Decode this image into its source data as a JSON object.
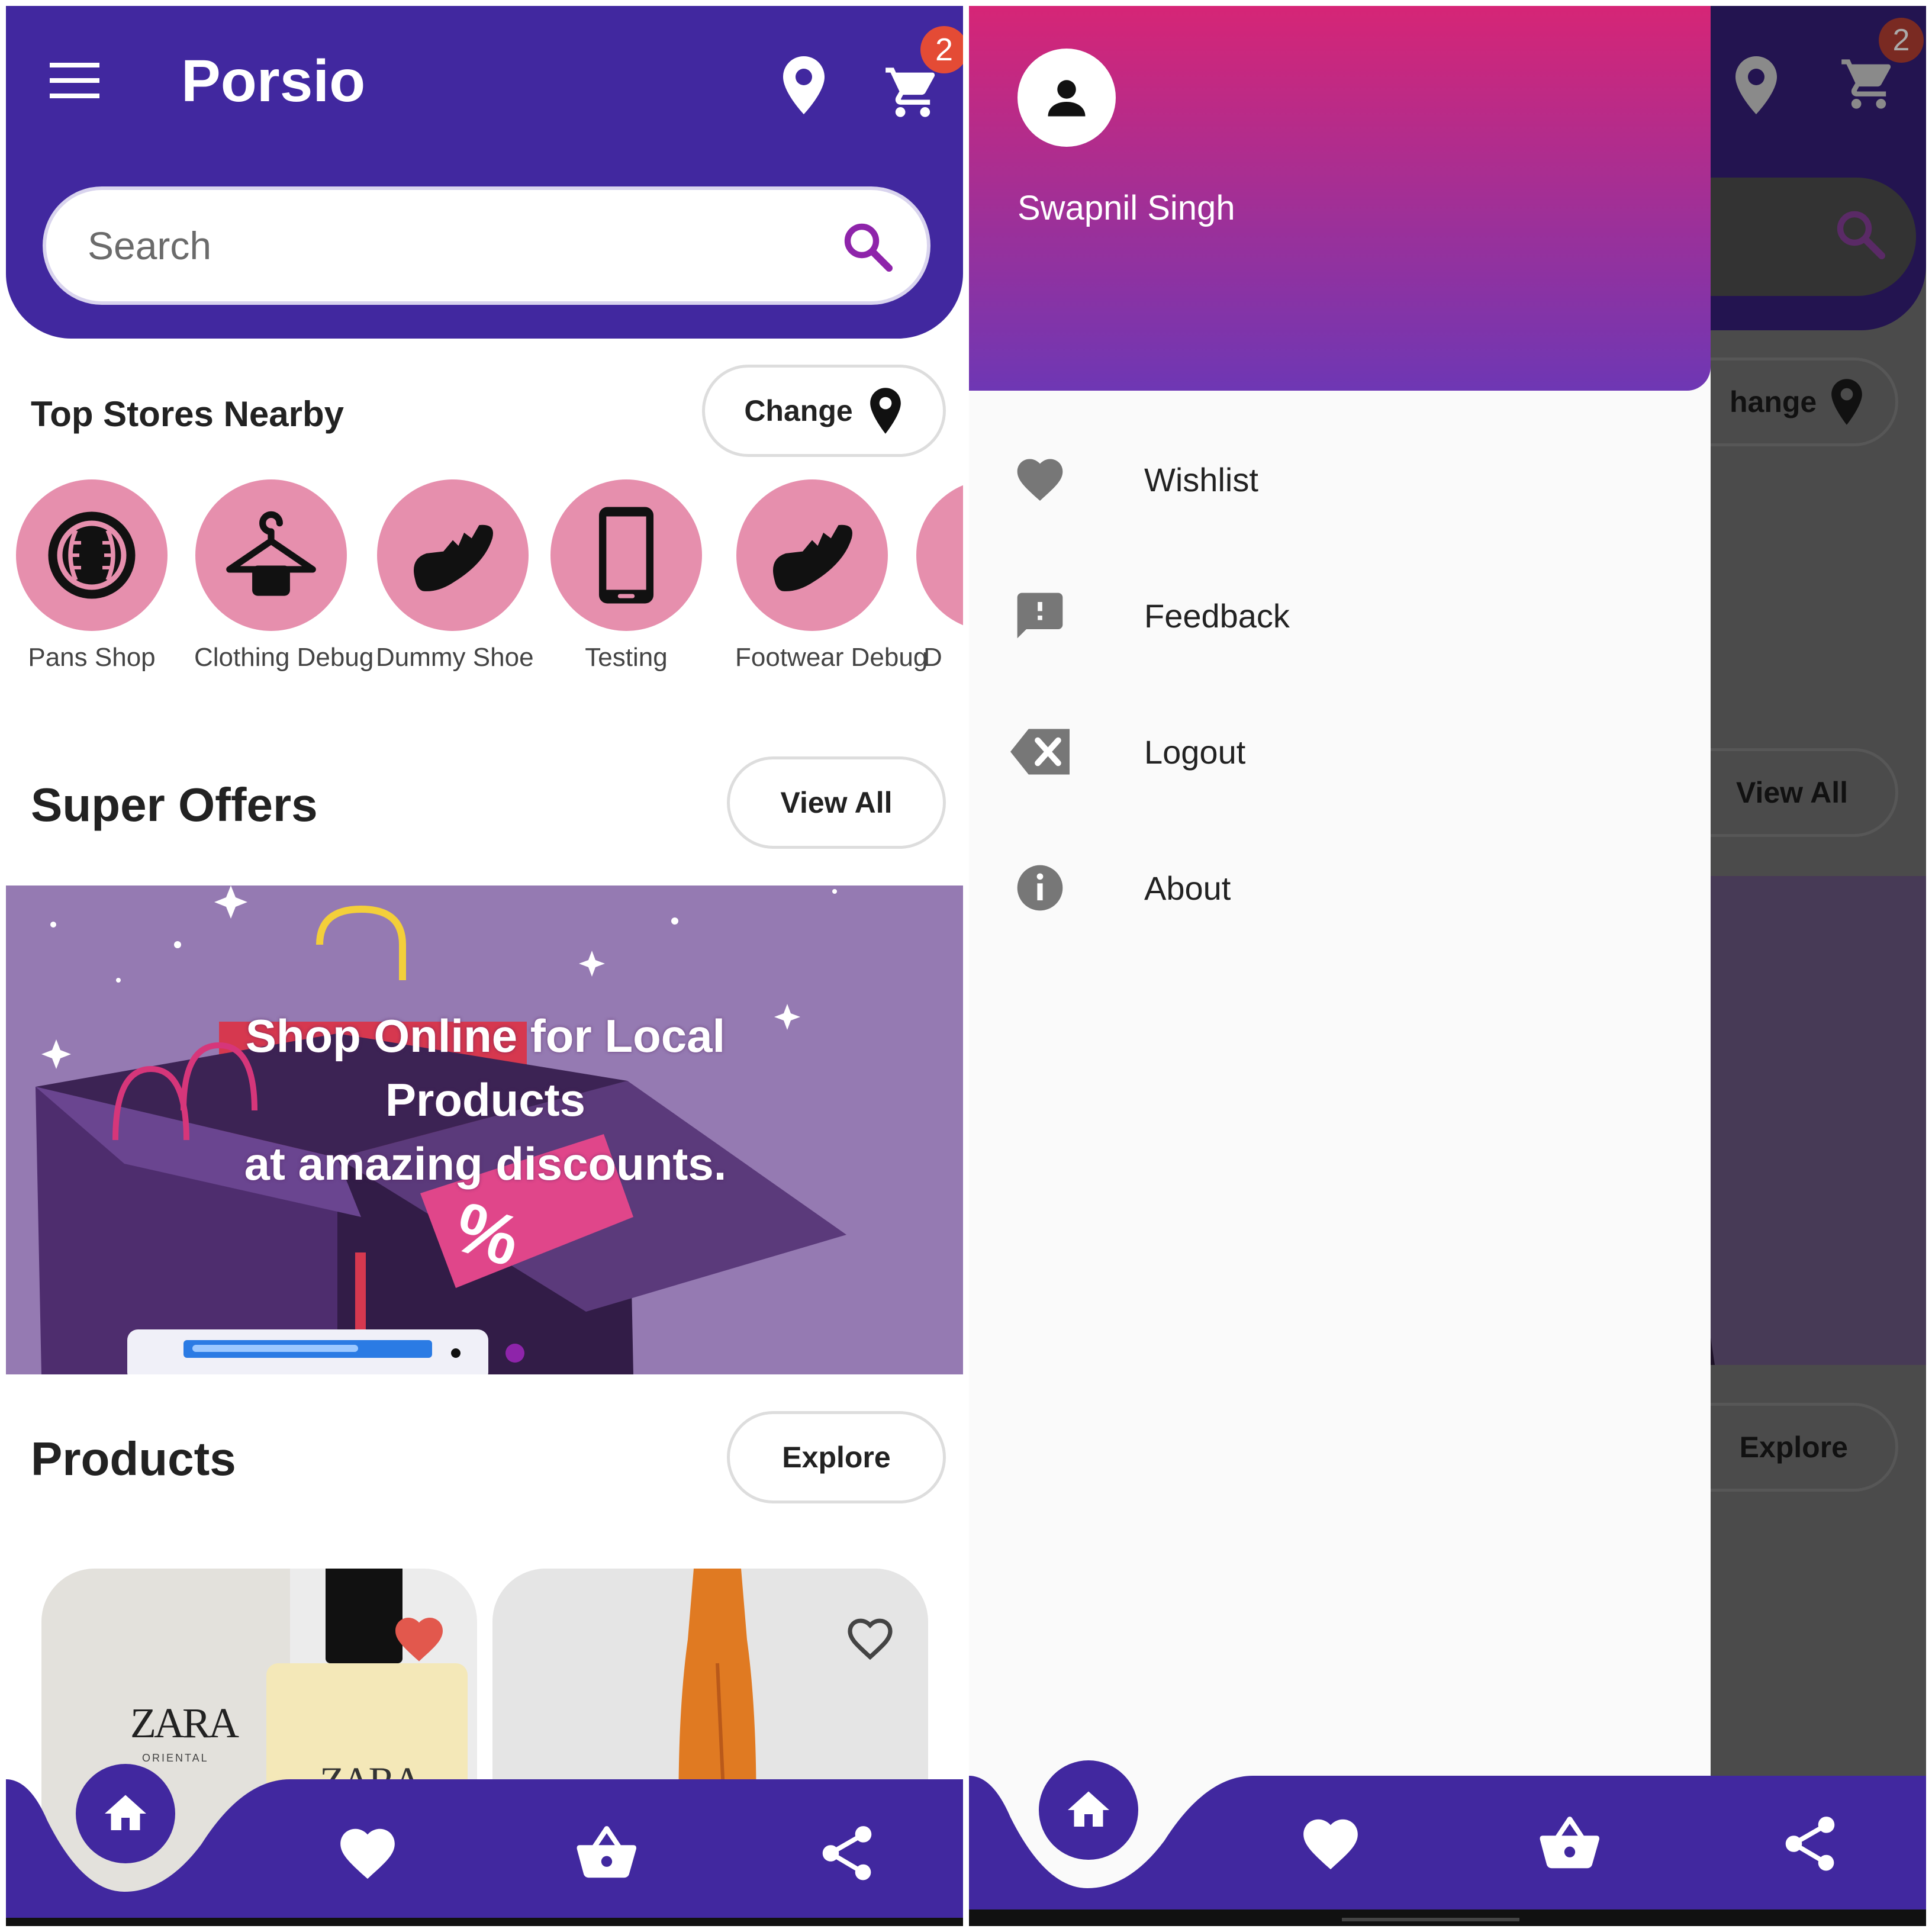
{
  "colors": {
    "primary": "#41289f",
    "accent_pink": "#e68fad",
    "badge": "#e44b35",
    "search_icon": "#8e24aa",
    "drawer_gradient_top": "#d62576",
    "drawer_gradient_bottom": "#6e37b4"
  },
  "home": {
    "app_title": "Porsio",
    "cart_count": "2",
    "search": {
      "placeholder": "Search"
    },
    "stores_section": {
      "title": "Top Stores Nearby",
      "change_label": "Change",
      "stores": [
        {
          "label": "Pans Shop",
          "icon": "baseball-icon"
        },
        {
          "label": "Clothing Debug",
          "icon": "hanger-icon"
        },
        {
          "label": "Dummy Shoe",
          "icon": "shoe-icon"
        },
        {
          "label": "Testing",
          "icon": "phone-icon"
        },
        {
          "label": "Footwear Debug",
          "icon": "shoe-icon"
        },
        {
          "label": "D",
          "icon": "store-icon"
        }
      ]
    },
    "offers_section": {
      "title": "Super Offers",
      "view_all_label": "View All",
      "banner_line1": "Shop Online for Local",
      "banner_line2": "Products",
      "banner_line3": "at amazing discounts.",
      "banner_tag": "%"
    },
    "products_section": {
      "title": "Products",
      "explore_label": "Explore",
      "items": [
        {
          "brand_text": "ZARA",
          "brand_sub": "ORIENTAL",
          "bottle_text": "ZARA",
          "wishlisted": true
        },
        {
          "wishlisted": false
        }
      ]
    },
    "bottom_nav": [
      "home-icon",
      "heart-icon",
      "basket-icon",
      "share-icon"
    ]
  },
  "drawer": {
    "user_name": "Swapnil Singh",
    "items": [
      {
        "label": "Wishlist",
        "icon": "heart-icon"
      },
      {
        "label": "Feedback",
        "icon": "feedback-icon"
      },
      {
        "label": "Logout",
        "icon": "backspace-icon"
      },
      {
        "label": "About",
        "icon": "info-icon"
      }
    ],
    "background_visible": {
      "cart_count": "2",
      "change_label": "hange",
      "view_all_label": "View All",
      "explore_label": "Explore"
    }
  }
}
